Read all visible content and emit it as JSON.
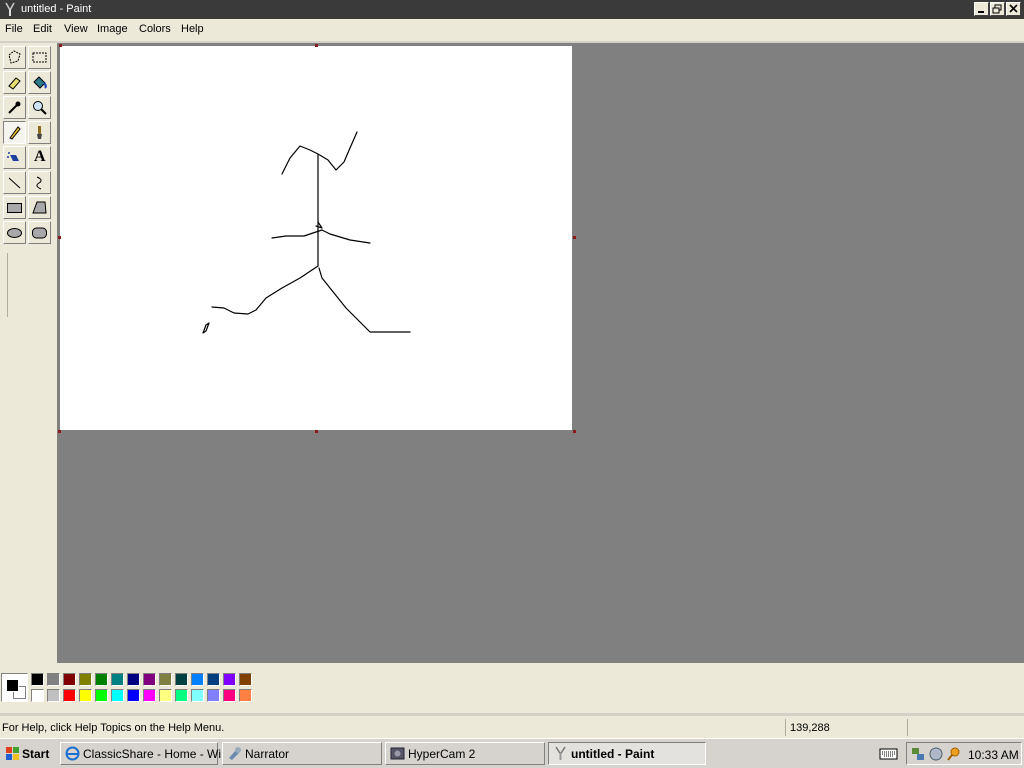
{
  "window": {
    "title": "untitled - Paint",
    "controls": [
      "minimize",
      "restore",
      "close"
    ]
  },
  "menu": [
    "File",
    "Edit",
    "View",
    "Image",
    "Colors",
    "Help"
  ],
  "tools": [
    {
      "name": "free-form-select-tool",
      "icon": "free-form-select-icon"
    },
    {
      "name": "select-tool",
      "icon": "rectangle-select-icon"
    },
    {
      "name": "eraser-tool",
      "icon": "eraser-icon"
    },
    {
      "name": "fill-tool",
      "icon": "paint-bucket-icon"
    },
    {
      "name": "pick-color-tool",
      "icon": "eyedropper-icon"
    },
    {
      "name": "magnifier-tool",
      "icon": "magnifier-icon"
    },
    {
      "name": "pencil-tool",
      "icon": "pencil-icon",
      "active": true
    },
    {
      "name": "brush-tool",
      "icon": "brush-icon"
    },
    {
      "name": "airbrush-tool",
      "icon": "airbrush-icon"
    },
    {
      "name": "text-tool",
      "icon": "text-icon",
      "label": "A"
    },
    {
      "name": "line-tool",
      "icon": "line-icon"
    },
    {
      "name": "curve-tool",
      "icon": "curve-icon"
    },
    {
      "name": "rectangle-tool",
      "icon": "rectangle-icon"
    },
    {
      "name": "polygon-tool",
      "icon": "polygon-icon"
    },
    {
      "name": "ellipse-tool",
      "icon": "ellipse-icon"
    },
    {
      "name": "rounded-rectangle-tool",
      "icon": "rounded-rectangle-icon"
    }
  ],
  "palette": {
    "foreground": "#000000",
    "background": "#ffffff",
    "colors_top": [
      "#000000",
      "#808080",
      "#800000",
      "#808000",
      "#008000",
      "#008080",
      "#000080",
      "#800080",
      "#808040",
      "#004040",
      "#0080ff",
      "#004080",
      "#8000ff",
      "#804000"
    ],
    "colors_bottom": [
      "#ffffff",
      "#c0c0c0",
      "#ff0000",
      "#ffff00",
      "#00ff00",
      "#00ffff",
      "#0000ff",
      "#ff00ff",
      "#ffff80",
      "#00ff80",
      "#80ffff",
      "#8080ff",
      "#ff0080",
      "#ff8040"
    ]
  },
  "status": {
    "help_text": "For Help, click Help Topics on the Help Menu.",
    "coordinates": "139,288"
  },
  "taskbar": {
    "start_label": "Start",
    "items": [
      {
        "label": "ClassicShare - Home - Wi...",
        "icon": "internet-explorer-icon"
      },
      {
        "label": "Narrator",
        "icon": "narrator-icon"
      },
      {
        "label": "HyperCam 2",
        "icon": "hypercam-icon"
      },
      {
        "label": "untitled - Paint",
        "icon": "paint-icon",
        "active": true
      }
    ],
    "tray_icons": [
      "keyboard-icon",
      "network-icon",
      "speaker-icon",
      "search-icon"
    ],
    "clock": "10:33 AM"
  }
}
